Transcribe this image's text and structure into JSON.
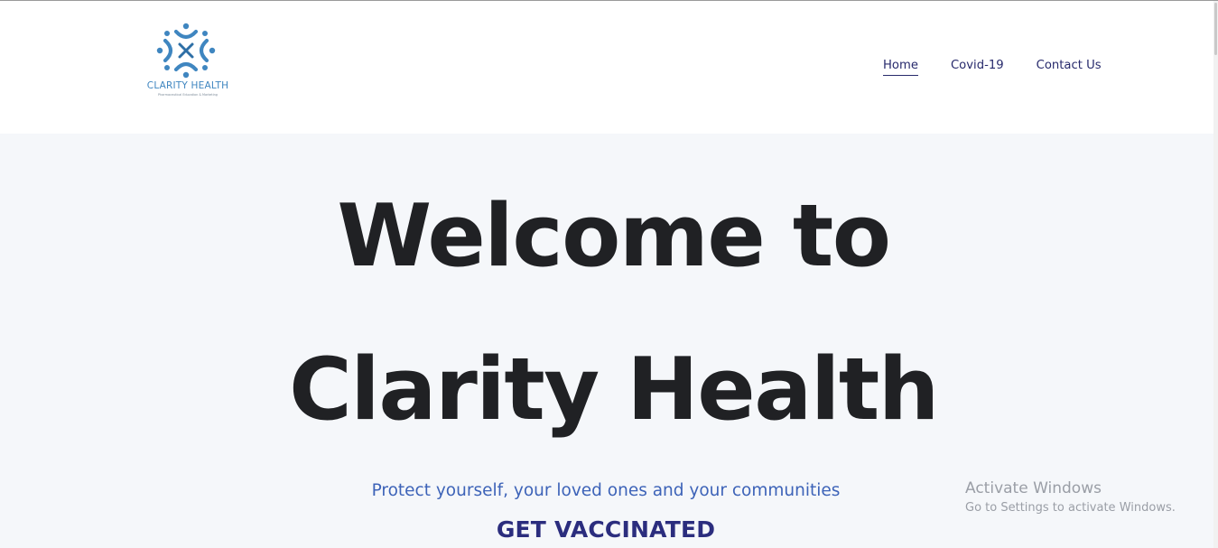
{
  "brand": {
    "name": "CLARITY HEALTH",
    "tagline": "Pharmaceutical Education & Marketing",
    "logo_icon": "clarity-health-logo-mark",
    "primary_color": "#3f86c0",
    "nav_color": "#272a6c"
  },
  "nav": {
    "items": [
      {
        "label": "Home",
        "active": true
      },
      {
        "label": "Covid-19",
        "active": false
      },
      {
        "label": "Contact Us",
        "active": false
      }
    ]
  },
  "hero": {
    "title_line_1": "Welcome to",
    "title_line_2": "Clarity Health",
    "subtitle": "Protect yourself, your loved ones and your communities",
    "cta": "GET VACCINATED",
    "background": "#f5f7fa",
    "title_color": "#202124",
    "subtitle_color": "#3d63b8",
    "cta_color": "#2b2d7e"
  },
  "os_watermark": {
    "title": "Activate Windows",
    "subtitle": "Go to Settings to activate Windows."
  }
}
